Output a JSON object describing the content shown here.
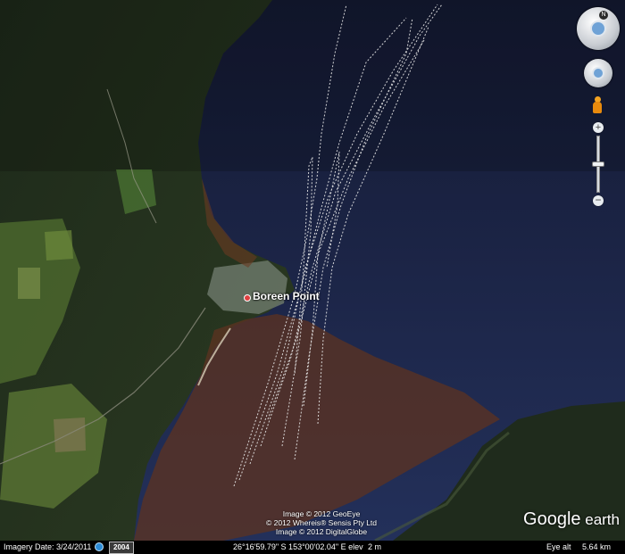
{
  "map": {
    "place_label": "Boreen Point",
    "credits": [
      "Image © 2012 GeoEye",
      "© 2012 Whereis® Sensis Pty Ltd",
      "Image © 2012 DigitalGlobe"
    ],
    "logo_google": "Google",
    "logo_earth": " earth"
  },
  "nav": {
    "compass_north": "N",
    "zoom_in": "+",
    "zoom_out": "−",
    "zoom_level": 0.5
  },
  "status": {
    "imagery_date": "Imagery Date: 3/24/2011",
    "history_year": "2004",
    "coords": "26°16'59.79\" S  153°00'02.04\" E  elev",
    "elev": "2 m",
    "eye_alt_label": "Eye alt",
    "eye_alt_value": "5.64 km"
  },
  "colors": {
    "water": "#1b2545",
    "land_forest": "#27361f",
    "land_fields": "#5d7a36",
    "sediment": "#6b3a22",
    "track": "#e8e8e8",
    "status_bg": "#000000"
  }
}
